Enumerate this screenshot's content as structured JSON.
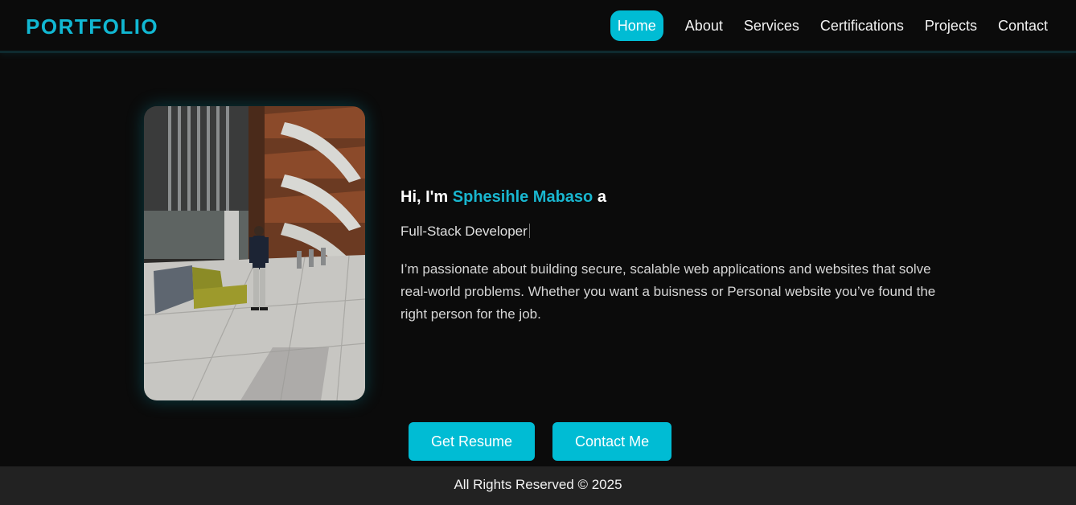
{
  "header": {
    "logo": "PORTFOLIO",
    "nav": [
      "Home",
      "About",
      "Services",
      "Certifications",
      "Projects",
      "Contact"
    ],
    "active": "Home"
  },
  "hero": {
    "greeting_prefix": "Hi, I'm",
    "name": "Sphesihle Mabaso",
    "greeting_suffix": "a",
    "role": "Full-Stack Developer",
    "bio": "I’m passionate about building secure, scalable web applications and websites that solve real-world problems. Whether you want a buisness or Personal website you’ve found the right person for the job."
  },
  "buttons": {
    "resume": "Get Resume",
    "contact": "Contact Me"
  },
  "footer": {
    "text": "All Rights Reserved © 2025"
  },
  "colors": {
    "accent": "#00bcd4",
    "background": "#0b0b0b",
    "footer": "#222222"
  }
}
